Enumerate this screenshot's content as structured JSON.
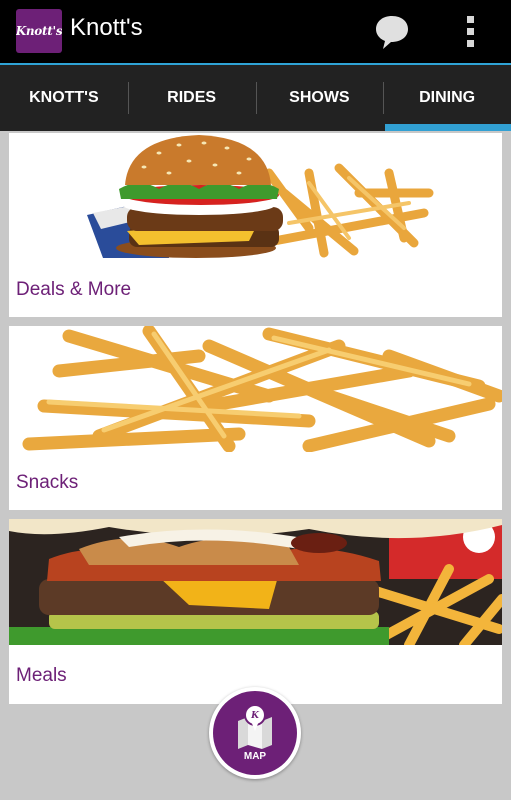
{
  "app": {
    "title": "Knott's",
    "icon_name": "knotts-app-icon",
    "icon_text": "Knott's"
  },
  "actions": [
    {
      "name": "chat-icon"
    },
    {
      "name": "overflow-menu-icon"
    }
  ],
  "tabs": [
    {
      "label": "KNOTT'S",
      "active": false
    },
    {
      "label": "RIDES",
      "active": false
    },
    {
      "label": "SHOWS",
      "active": false
    },
    {
      "label": "DINING",
      "active": true
    }
  ],
  "cards": [
    {
      "label": "Deals & More",
      "image": "burger-and-fries-photo"
    },
    {
      "label": "Snacks",
      "image": "french-fries-photo"
    },
    {
      "label": "Meals",
      "image": "bacon-burger-photo"
    }
  ],
  "map_button": {
    "label": "MAP",
    "icon": "map-icon"
  },
  "colors": {
    "brand_purple": "#6d2077",
    "tab_indicator": "#31a0d3",
    "actionbar": "#000000",
    "tabbar": "#222222",
    "background": "#c8c8c8"
  }
}
